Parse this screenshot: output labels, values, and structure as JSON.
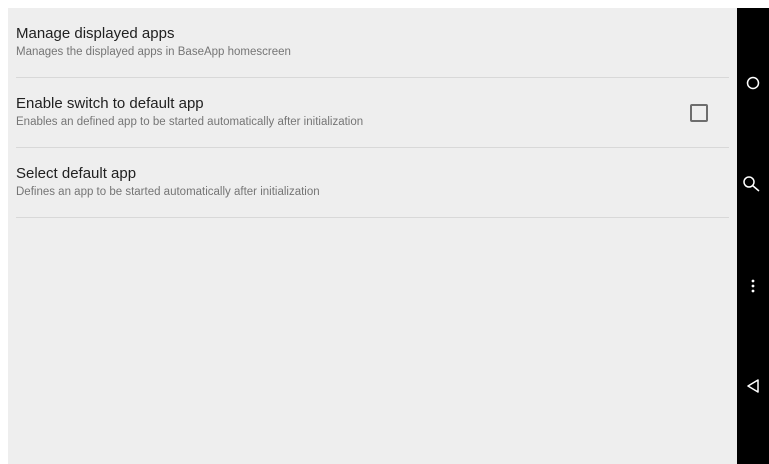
{
  "preferences": [
    {
      "title": "Manage displayed apps",
      "summary": "Manages the displayed apps in BaseApp homescreen"
    },
    {
      "title": "Enable switch to default app",
      "summary": "Enables an defined app to be started automatically after initialization",
      "checked": false
    },
    {
      "title": "Select default app",
      "summary": "Defines an app to be started automatically after initialization"
    }
  ],
  "navbar": {
    "buttons": [
      "home-icon",
      "search-icon",
      "more-vert-icon",
      "back-icon"
    ]
  },
  "colors": {
    "background": "#eeeeee",
    "title_text": "#212121",
    "summary_text": "#757575",
    "navbar": "#000000"
  }
}
